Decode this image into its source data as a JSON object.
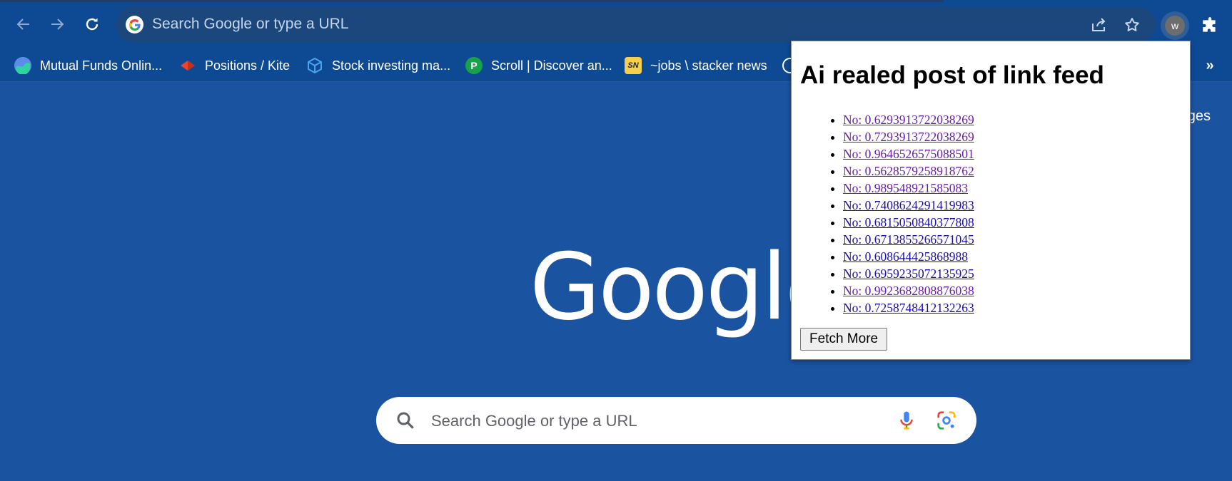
{
  "toolbar": {
    "omnibox_placeholder": "Search Google or type a URL",
    "profile_initial": "w"
  },
  "bookmarks": [
    {
      "label": "Mutual Funds Onlin...",
      "icon": "kuvera-icon"
    },
    {
      "label": "Positions / Kite",
      "icon": "kite-icon"
    },
    {
      "label": "Stock investing ma...",
      "icon": "box-icon"
    },
    {
      "label": "Scroll | Discover an...",
      "icon": "scroll-icon",
      "fav_text": "P"
    },
    {
      "label": "~jobs \\ stacker news",
      "icon": "stacker-news-icon",
      "fav_text": "SN"
    }
  ],
  "bookmarks_more": "»",
  "ntp": {
    "images_link": "mages",
    "logo_text": "Google",
    "search_placeholder": "Search Google or type a URL"
  },
  "popup": {
    "title": "Ai realed post of link feed",
    "links": [
      {
        "text": "No: 0.6293913722038269",
        "visited": true
      },
      {
        "text": "No: 0.7293913722038269",
        "visited": true
      },
      {
        "text": "No: 0.9646526575088501",
        "visited": true
      },
      {
        "text": "No: 0.5628579258918762",
        "visited": true
      },
      {
        "text": "No: 0.989548921585083",
        "visited": true
      },
      {
        "text": "No: 0.7408624291419983",
        "visited": false
      },
      {
        "text": "No: 0.6815050840377808",
        "visited": false
      },
      {
        "text": "No: 0.6713855266571045",
        "visited": false
      },
      {
        "text": "No: 0.608644425868988",
        "visited": false
      },
      {
        "text": "No: 0.6959235072135925",
        "visited": false
      },
      {
        "text": "No: 0.9923682808876038",
        "visited": true
      },
      {
        "text": "No: 0.7258748412132263",
        "visited": false
      }
    ],
    "fetch_button": "Fetch More"
  },
  "colors": {
    "page_bg": "#1a53a0",
    "toolbar_bg": "#0e4a93",
    "visited_link": "#681da8",
    "unvisited_link": "#1a0dab"
  }
}
